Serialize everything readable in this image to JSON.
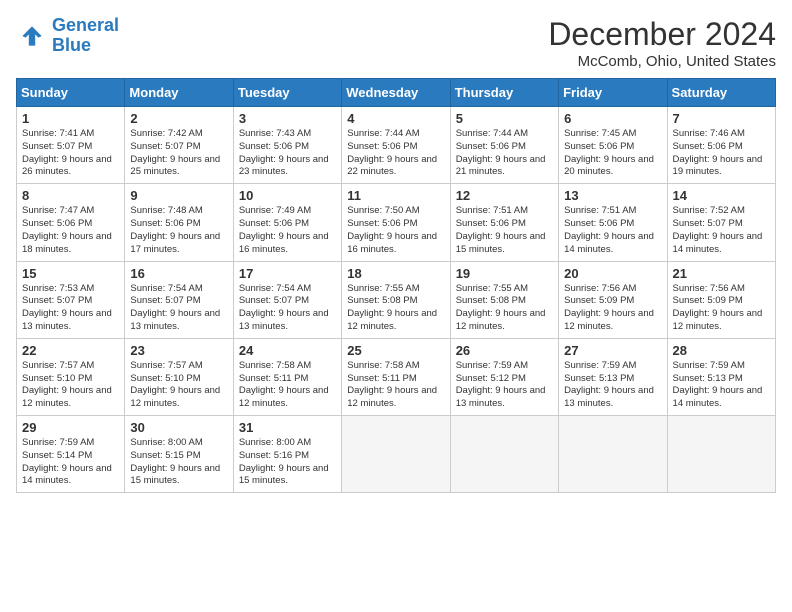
{
  "header": {
    "logo_line1": "General",
    "logo_line2": "Blue",
    "main_title": "December 2024",
    "subtitle": "McComb, Ohio, United States"
  },
  "columns": [
    "Sunday",
    "Monday",
    "Tuesday",
    "Wednesday",
    "Thursday",
    "Friday",
    "Saturday"
  ],
  "weeks": [
    [
      {
        "day": "1",
        "sunrise": "Sunrise: 7:41 AM",
        "sunset": "Sunset: 5:07 PM",
        "daylight": "Daylight: 9 hours and 26 minutes."
      },
      {
        "day": "2",
        "sunrise": "Sunrise: 7:42 AM",
        "sunset": "Sunset: 5:07 PM",
        "daylight": "Daylight: 9 hours and 25 minutes."
      },
      {
        "day": "3",
        "sunrise": "Sunrise: 7:43 AM",
        "sunset": "Sunset: 5:06 PM",
        "daylight": "Daylight: 9 hours and 23 minutes."
      },
      {
        "day": "4",
        "sunrise": "Sunrise: 7:44 AM",
        "sunset": "Sunset: 5:06 PM",
        "daylight": "Daylight: 9 hours and 22 minutes."
      },
      {
        "day": "5",
        "sunrise": "Sunrise: 7:44 AM",
        "sunset": "Sunset: 5:06 PM",
        "daylight": "Daylight: 9 hours and 21 minutes."
      },
      {
        "day": "6",
        "sunrise": "Sunrise: 7:45 AM",
        "sunset": "Sunset: 5:06 PM",
        "daylight": "Daylight: 9 hours and 20 minutes."
      },
      {
        "day": "7",
        "sunrise": "Sunrise: 7:46 AM",
        "sunset": "Sunset: 5:06 PM",
        "daylight": "Daylight: 9 hours and 19 minutes."
      }
    ],
    [
      {
        "day": "8",
        "sunrise": "Sunrise: 7:47 AM",
        "sunset": "Sunset: 5:06 PM",
        "daylight": "Daylight: 9 hours and 18 minutes."
      },
      {
        "day": "9",
        "sunrise": "Sunrise: 7:48 AM",
        "sunset": "Sunset: 5:06 PM",
        "daylight": "Daylight: 9 hours and 17 minutes."
      },
      {
        "day": "10",
        "sunrise": "Sunrise: 7:49 AM",
        "sunset": "Sunset: 5:06 PM",
        "daylight": "Daylight: 9 hours and 16 minutes."
      },
      {
        "day": "11",
        "sunrise": "Sunrise: 7:50 AM",
        "sunset": "Sunset: 5:06 PM",
        "daylight": "Daylight: 9 hours and 16 minutes."
      },
      {
        "day": "12",
        "sunrise": "Sunrise: 7:51 AM",
        "sunset": "Sunset: 5:06 PM",
        "daylight": "Daylight: 9 hours and 15 minutes."
      },
      {
        "day": "13",
        "sunrise": "Sunrise: 7:51 AM",
        "sunset": "Sunset: 5:06 PM",
        "daylight": "Daylight: 9 hours and 14 minutes."
      },
      {
        "day": "14",
        "sunrise": "Sunrise: 7:52 AM",
        "sunset": "Sunset: 5:07 PM",
        "daylight": "Daylight: 9 hours and 14 minutes."
      }
    ],
    [
      {
        "day": "15",
        "sunrise": "Sunrise: 7:53 AM",
        "sunset": "Sunset: 5:07 PM",
        "daylight": "Daylight: 9 hours and 13 minutes."
      },
      {
        "day": "16",
        "sunrise": "Sunrise: 7:54 AM",
        "sunset": "Sunset: 5:07 PM",
        "daylight": "Daylight: 9 hours and 13 minutes."
      },
      {
        "day": "17",
        "sunrise": "Sunrise: 7:54 AM",
        "sunset": "Sunset: 5:07 PM",
        "daylight": "Daylight: 9 hours and 13 minutes."
      },
      {
        "day": "18",
        "sunrise": "Sunrise: 7:55 AM",
        "sunset": "Sunset: 5:08 PM",
        "daylight": "Daylight: 9 hours and 12 minutes."
      },
      {
        "day": "19",
        "sunrise": "Sunrise: 7:55 AM",
        "sunset": "Sunset: 5:08 PM",
        "daylight": "Daylight: 9 hours and 12 minutes."
      },
      {
        "day": "20",
        "sunrise": "Sunrise: 7:56 AM",
        "sunset": "Sunset: 5:09 PM",
        "daylight": "Daylight: 9 hours and 12 minutes."
      },
      {
        "day": "21",
        "sunrise": "Sunrise: 7:56 AM",
        "sunset": "Sunset: 5:09 PM",
        "daylight": "Daylight: 9 hours and 12 minutes."
      }
    ],
    [
      {
        "day": "22",
        "sunrise": "Sunrise: 7:57 AM",
        "sunset": "Sunset: 5:10 PM",
        "daylight": "Daylight: 9 hours and 12 minutes."
      },
      {
        "day": "23",
        "sunrise": "Sunrise: 7:57 AM",
        "sunset": "Sunset: 5:10 PM",
        "daylight": "Daylight: 9 hours and 12 minutes."
      },
      {
        "day": "24",
        "sunrise": "Sunrise: 7:58 AM",
        "sunset": "Sunset: 5:11 PM",
        "daylight": "Daylight: 9 hours and 12 minutes."
      },
      {
        "day": "25",
        "sunrise": "Sunrise: 7:58 AM",
        "sunset": "Sunset: 5:11 PM",
        "daylight": "Daylight: 9 hours and 12 minutes."
      },
      {
        "day": "26",
        "sunrise": "Sunrise: 7:59 AM",
        "sunset": "Sunset: 5:12 PM",
        "daylight": "Daylight: 9 hours and 13 minutes."
      },
      {
        "day": "27",
        "sunrise": "Sunrise: 7:59 AM",
        "sunset": "Sunset: 5:13 PM",
        "daylight": "Daylight: 9 hours and 13 minutes."
      },
      {
        "day": "28",
        "sunrise": "Sunrise: 7:59 AM",
        "sunset": "Sunset: 5:13 PM",
        "daylight": "Daylight: 9 hours and 14 minutes."
      }
    ],
    [
      {
        "day": "29",
        "sunrise": "Sunrise: 7:59 AM",
        "sunset": "Sunset: 5:14 PM",
        "daylight": "Daylight: 9 hours and 14 minutes."
      },
      {
        "day": "30",
        "sunrise": "Sunrise: 8:00 AM",
        "sunset": "Sunset: 5:15 PM",
        "daylight": "Daylight: 9 hours and 15 minutes."
      },
      {
        "day": "31",
        "sunrise": "Sunrise: 8:00 AM",
        "sunset": "Sunset: 5:16 PM",
        "daylight": "Daylight: 9 hours and 15 minutes."
      },
      null,
      null,
      null,
      null
    ]
  ]
}
